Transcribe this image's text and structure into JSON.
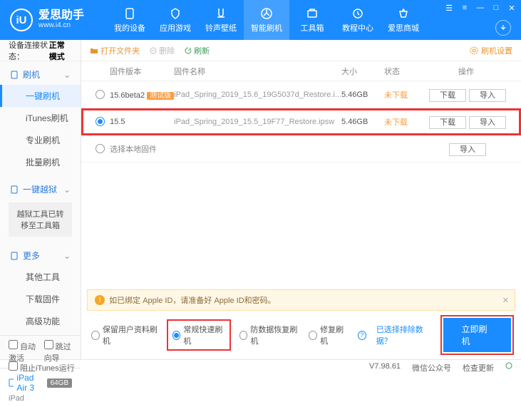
{
  "app": {
    "title": "爱思助手",
    "url": "www.i4.cn"
  },
  "winControls": [
    "☰",
    "≡",
    "—",
    "□",
    "✕"
  ],
  "nav": [
    {
      "label": "我的设备"
    },
    {
      "label": "应用游戏"
    },
    {
      "label": "铃声壁纸"
    },
    {
      "label": "智能刷机",
      "active": true
    },
    {
      "label": "工具箱"
    },
    {
      "label": "教程中心"
    },
    {
      "label": "爱思商城"
    }
  ],
  "status": {
    "label": "设备连接状态：",
    "value": "正常模式"
  },
  "sidebar": {
    "groups": [
      {
        "header": "刷机",
        "icon": "phone",
        "items": [
          {
            "label": "一键刷机",
            "active": true
          },
          {
            "label": "iTunes刷机"
          },
          {
            "label": "专业刷机"
          },
          {
            "label": "批量刷机"
          }
        ]
      },
      {
        "header": "一键越狱",
        "icon": "lock",
        "box": "越狱工具已转移至工具箱"
      },
      {
        "header": "更多",
        "icon": "more",
        "items": [
          {
            "label": "其他工具"
          },
          {
            "label": "下载固件"
          },
          {
            "label": "高级功能"
          }
        ]
      }
    ],
    "checks": [
      {
        "label": "自动激活"
      },
      {
        "label": "跳过向导"
      }
    ],
    "device": {
      "name": "iPad Air 3",
      "badge": "64GB",
      "type": "iPad"
    }
  },
  "toolbar": {
    "open": "打开文件夹",
    "delete": "删除",
    "refresh": "刷新",
    "settings": "刷机设置"
  },
  "table": {
    "headers": {
      "version": "固件版本",
      "name": "固件名称",
      "size": "大小",
      "status": "状态",
      "ops": "操作"
    },
    "rows": [
      {
        "selected": false,
        "version": "15.6beta2",
        "tag": "测试版",
        "name": "iPad_Spring_2019_15.6_19G5037d_Restore.i...",
        "size": "5.46GB",
        "status": "未下载",
        "btns": [
          "下载",
          "导入"
        ]
      },
      {
        "selected": true,
        "version": "15.5",
        "name": "iPad_Spring_2019_15.5_19F77_Restore.ipsw",
        "size": "5.46GB",
        "status": "未下载",
        "btns": [
          "下载",
          "导入"
        ]
      },
      {
        "local": true,
        "label": "选择本地固件",
        "btns": [
          "导入"
        ]
      }
    ]
  },
  "warning": "如已绑定 Apple ID，请准备好 Apple ID和密码。",
  "options": [
    {
      "label": "保留用户资料刷机"
    },
    {
      "label": "常规快速刷机",
      "selected": true,
      "boxed": true
    },
    {
      "label": "防数据恢复刷机"
    },
    {
      "label": "修复刷机"
    }
  ],
  "excludeLink": "已选择排除数据？",
  "primaryBtn": "立即刷机",
  "footer": {
    "block": "阻止iTunes运行",
    "version": "V7.98.61",
    "wechat": "微信公众号",
    "update": "检查更新"
  }
}
